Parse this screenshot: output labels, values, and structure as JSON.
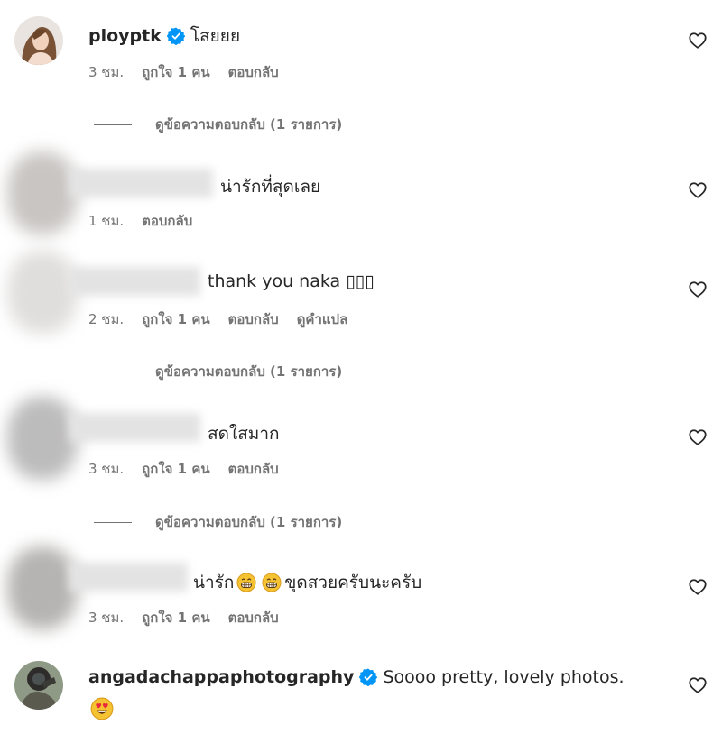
{
  "comments": [
    {
      "username": "ployptk",
      "verified": true,
      "text": "โสยยย",
      "time": "3 ชม.",
      "likes": "ถูกใจ 1 คน",
      "reply": "ตอบกลับ",
      "view_replies": "ดูข้อความตอบกลับ (1 รายการ)"
    },
    {
      "text": "น่ารักที่สุดเลย",
      "time": "1 ชม.",
      "reply": "ตอบกลับ"
    },
    {
      "text": "thank you naka ▯▯▯",
      "time": "2 ชม.",
      "likes": "ถูกใจ 1 คน",
      "reply": "ตอบกลับ",
      "translate": "ดูคำแปล",
      "view_replies": "ดูข้อความตอบกลับ (1 รายการ)"
    },
    {
      "text": "สดใสมาก",
      "time": "3 ชม.",
      "likes": "ถูกใจ 1 คน",
      "reply": "ตอบกลับ",
      "view_replies": "ดูข้อความตอบกลับ (1 รายการ)"
    },
    {
      "text_before": "น่ารัก",
      "text_after": "ขุดสวยครับนะครับ",
      "emoji": "grinning-face-emoji",
      "time": "3 ชม.",
      "likes": "ถูกใจ 1 คน",
      "reply": "ตอบกลับ"
    },
    {
      "username": "angadachappaphotography",
      "verified": true,
      "text": "Soooo pretty, lovely photos.",
      "emoji": "heart-eyes-emoji"
    }
  ],
  "icons": {
    "like": "heart-outline-icon",
    "verified": "verified-badge-icon"
  },
  "colors": {
    "text": "#262626",
    "secondary": "#737373",
    "verified": "#0095f6"
  }
}
